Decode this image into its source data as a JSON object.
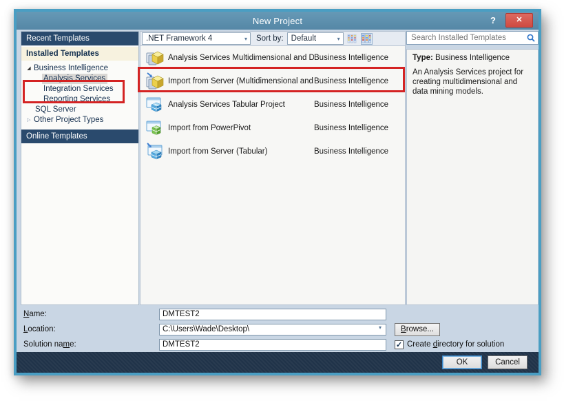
{
  "window": {
    "title": "New Project",
    "help_glyph": "?",
    "close_glyph": "✕"
  },
  "sidebar": {
    "recent_header": "Recent Templates",
    "installed_header": "Installed Templates",
    "online_header": "Online Templates",
    "tree": [
      {
        "label": "Business Intelligence",
        "state": "expanded"
      },
      {
        "label": "Analysis Services",
        "state": "selected"
      },
      {
        "label": "Integration Services",
        "state": "normal"
      },
      {
        "label": "Reporting Services",
        "state": "normal"
      },
      {
        "label": "SQL Server",
        "state": "normal"
      },
      {
        "label": "Other Project Types",
        "state": "collapsed"
      }
    ]
  },
  "icons": {
    "expand_glyph": "◢",
    "collapse_glyph": "▷",
    "chevron_glyph": "▾",
    "check_glyph": "✓"
  },
  "toolbar": {
    "framework_value": ".NET Framework 4",
    "sortby_label": "Sort by:",
    "sort_value": "Default"
  },
  "search": {
    "placeholder": "Search Installed Templates"
  },
  "templates": [
    {
      "name": "Analysis Services Multidimensional and Da...",
      "category": "Business Intelligence",
      "icon": "analysis-services-multidimensional-icon"
    },
    {
      "name": "Import from Server (Multidimensional and...",
      "category": "Business Intelligence",
      "icon": "import-server-multidimensional-icon"
    },
    {
      "name": "Analysis Services Tabular Project",
      "category": "Business Intelligence",
      "icon": "analysis-services-tabular-icon"
    },
    {
      "name": "Import from PowerPivot",
      "category": "Business Intelligence",
      "icon": "import-powerpivot-icon"
    },
    {
      "name": "Import from Server (Tabular)",
      "category": "Business Intelligence",
      "icon": "import-server-tabular-icon"
    }
  ],
  "details": {
    "type_label": "Type:",
    "type_value": "Business Intelligence",
    "description": "An Analysis Services project for creating multidimensional and data mining models."
  },
  "form": {
    "name_label": {
      "pre": "",
      "mn": "N",
      "post": "ame:"
    },
    "name_value": "DMTEST2",
    "location_label": {
      "pre": "",
      "mn": "L",
      "post": "ocation:"
    },
    "location_value": "C:\\Users\\Wade\\Desktop\\",
    "solution_label": {
      "pre": "Solution na",
      "mn": "m",
      "post": "e:"
    },
    "solution_value": "DMTEST2",
    "browse_label": {
      "pre": "",
      "mn": "B",
      "post": "rowse..."
    },
    "checkbox_label": {
      "pre": "Create ",
      "mn": "d",
      "post": "irectory for solution"
    },
    "checkbox_checked": true
  },
  "footer": {
    "ok_label": "OK",
    "cancel_label": "Cancel"
  },
  "colors": {
    "frame": "#4a9ec3",
    "titlebar": "#5d92b2",
    "header_navy": "#2a4a6d",
    "installed_highlight": "#f7f2df",
    "footer_navy": "#203349",
    "annotation_red": "#d42323",
    "content_bg": "#c9d6e4"
  }
}
